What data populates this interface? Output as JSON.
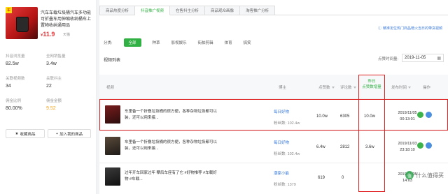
{
  "product": {
    "title": "汽车车载垃圾桶汽车多功能可折叠车用伸缩收纳桶车上置物收纳通用品",
    "price_symbol": "¥",
    "price": "11.9",
    "source": "天猫",
    "thumb_tag": "车"
  },
  "stats": [
    {
      "label": "抖音浏览量",
      "value": "82.5w"
    },
    {
      "label": "全网销售量",
      "value": "3.4w"
    },
    {
      "label": "关联视频数",
      "value": "34"
    },
    {
      "label": "关联抖主",
      "value": "22"
    },
    {
      "label": "佣金比例",
      "value": "80.00%"
    },
    {
      "label": "佣金金额",
      "value": "9.52"
    }
  ],
  "left_buttons": {
    "collect": "收藏商品",
    "add_mine": "加入我的商品"
  },
  "tabs": [
    "商品热度分析",
    "抖音推广视频",
    "在售抖主分析",
    "商品观众画像",
    "淘客推广分析"
  ],
  "tip_link": "精准定位热门商品榜火当日的带货视频",
  "categories": {
    "label": "分类:",
    "items": [
      "全部",
      "种草",
      "影视娱乐",
      "街拍剪辑",
      "体育",
      "搞笑"
    ]
  },
  "section_title": "视频列表",
  "date": {
    "label": "点赞时间量:",
    "value": "2019-11-05"
  },
  "table": {
    "headers": {
      "video": "视频",
      "blogger": "博主",
      "likes": "点赞数",
      "comments": "评论数",
      "today_likes": "昨日\n点赞数增量",
      "published": "发布时间",
      "actions": "操作"
    },
    "rows": [
      {
        "title": "车里备一个折叠垃圾桶的很方便，各种杂物垃圾都可以装，还可以用来接...",
        "blogger": "每日好物",
        "fans_label": "粉丝数:",
        "fans": "102.4w",
        "likes": "10.0w",
        "comments": "6305",
        "increment": "10.0w",
        "date": "2019/11/05",
        "time": "00:13:01"
      },
      {
        "title": "车里备一个折叠垃圾桶的很方便，各种杂物垃圾都可以装，还可以用来接...",
        "blogger": "每日好物",
        "fans_label": "粉丝数:",
        "fans": "102.4w",
        "likes": "6.4w",
        "comments": "2812",
        "increment": "3.6w",
        "date": "2019/11/03",
        "time": "23:18:10"
      },
      {
        "title": "过年开车回家过年 攀后车座有了它 #好物推荐 #车载好物 #车载...",
        "blogger": "潮家小能",
        "fans_label": "粉丝数:",
        "fans": "1379",
        "likes": "619",
        "comments": "0",
        "increment": "",
        "date": "2019/11/05",
        "time": "14:03"
      }
    ]
  },
  "watermark": "什么值得买"
}
